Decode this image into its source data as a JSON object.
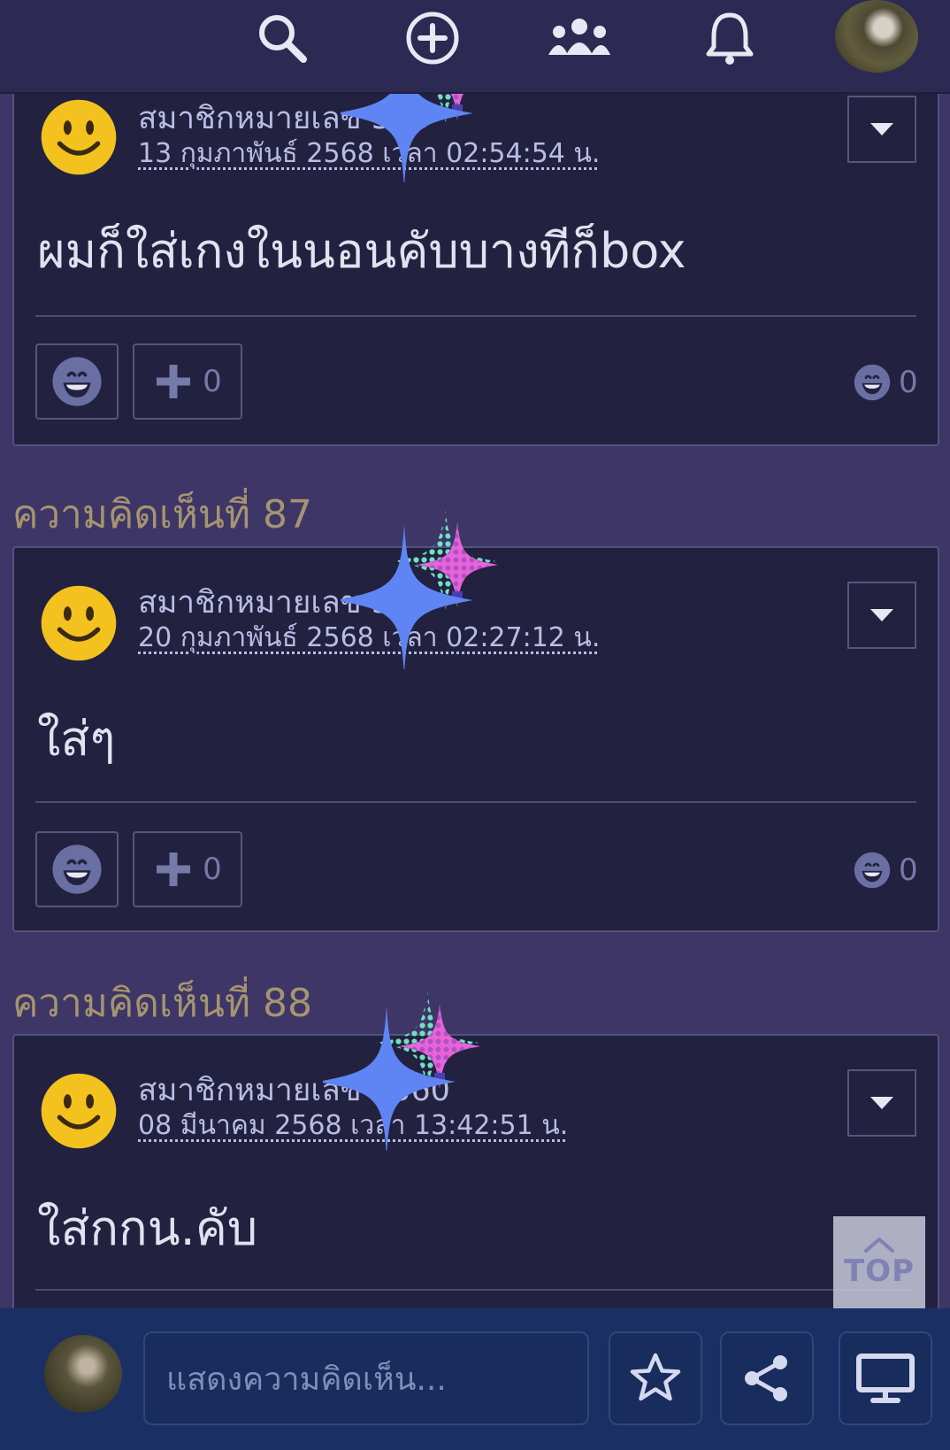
{
  "topbar": {
    "icons": [
      "search-icon",
      "add-post-icon",
      "community-icon",
      "notification-bell-icon",
      "profile-avatar"
    ]
  },
  "comments": [
    {
      "author": "สมาชิกหมายเลข 360",
      "date": "13 กุมภาพันธ์ 2568 เวลา 02:54:54 น.",
      "text": "ผมก็ใส่เกงในนอนคับบางทีก็box",
      "plus_count": "0",
      "reaction_count": "0"
    },
    {
      "label": "ความคิดเห็นที่ 87",
      "author": "สมาชิกหมายเลข 360",
      "date": "20 กุมภาพันธ์ 2568 เวลา 02:27:12 น.",
      "text": "ใส่ๆ",
      "plus_count": "0",
      "reaction_count": "0"
    },
    {
      "label": "ความคิดเห็นที่ 88",
      "author": "สมาชิกหมายเลข 2360",
      "date": "08 มีนาคม 2568 เวลา 13:42:51 น.",
      "text": "ใส่กกน.คับ"
    }
  ],
  "top_button": {
    "label": "TOP"
  },
  "bottombar": {
    "comment_placeholder": "แสดงความคิดเห็น...",
    "icons": [
      "star-icon",
      "share-icon",
      "desktop-icon"
    ]
  },
  "colors": {
    "page_bg": "#3e3666",
    "card_bg": "#22213f",
    "label_gold": "#a69471",
    "link_blue": "#b9bde4",
    "bottombar_bg": "#1a2f63"
  }
}
